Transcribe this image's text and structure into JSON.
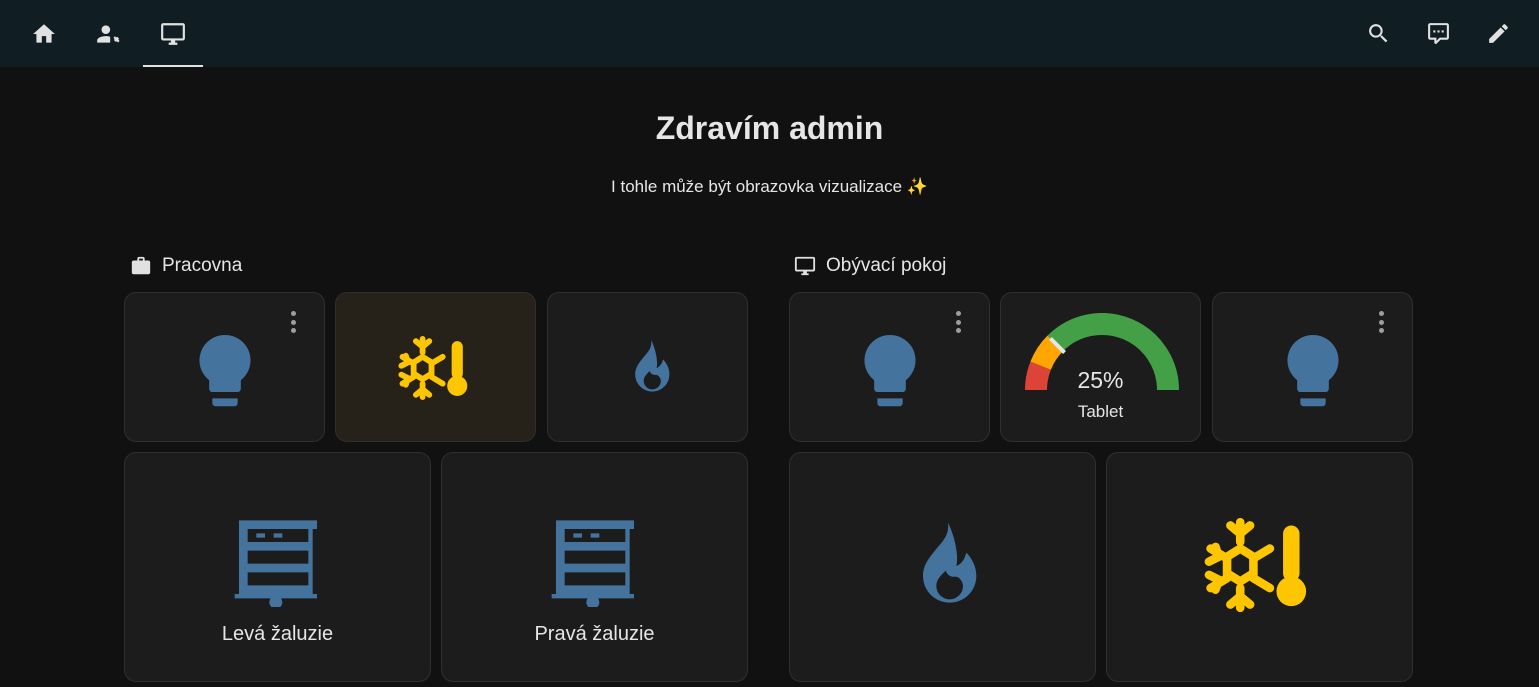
{
  "topbar": {
    "tabs": [
      {
        "icon": "home-icon"
      },
      {
        "icon": "account-wrench-icon"
      },
      {
        "icon": "monitor-icon",
        "active": true
      }
    ],
    "actions": [
      {
        "icon": "search-icon"
      },
      {
        "icon": "assist-chat-icon"
      },
      {
        "icon": "pencil-icon"
      }
    ],
    "bg_color": "#101e24"
  },
  "main": {
    "title": "Zdravím admin",
    "subtitle": "I tohle může být obrazovka vizualizace ✨"
  },
  "sections": [
    {
      "title": "Pracovna",
      "icon": "briefcase-icon",
      "cards": [
        {
          "icon": "lightbulb-icon",
          "color": "#44739e",
          "has_menu": true
        },
        {
          "icon": "snowflake-thermometer-icon",
          "color": "#fdc600",
          "has_menu": false
        },
        {
          "icon": "fire-icon",
          "color": "#44739e",
          "has_menu": false
        },
        {
          "icon": "window-shutter-icon",
          "color": "#44739e",
          "label": "Levá žaluzie"
        },
        {
          "icon": "window-shutter-icon",
          "color": "#44739e",
          "label": "Pravá žaluzie"
        }
      ]
    },
    {
      "title": "Obývací pokoj",
      "icon": "monitor-icon",
      "cards": [
        {
          "icon": "lightbulb-icon",
          "color": "#44739e",
          "has_menu": true
        },
        {
          "type": "gauge",
          "value": 25,
          "value_text": "25%",
          "name": "Tablet",
          "segment_colors": [
            "#db4437",
            "#ffa600",
            "#43a047"
          ]
        },
        {
          "icon": "lightbulb-icon",
          "color": "#44739e",
          "has_menu": true
        },
        {
          "icon": "fire-icon",
          "color": "#44739e"
        },
        {
          "icon": "snowflake-thermometer-icon",
          "color": "#fdc600"
        }
      ]
    }
  ]
}
